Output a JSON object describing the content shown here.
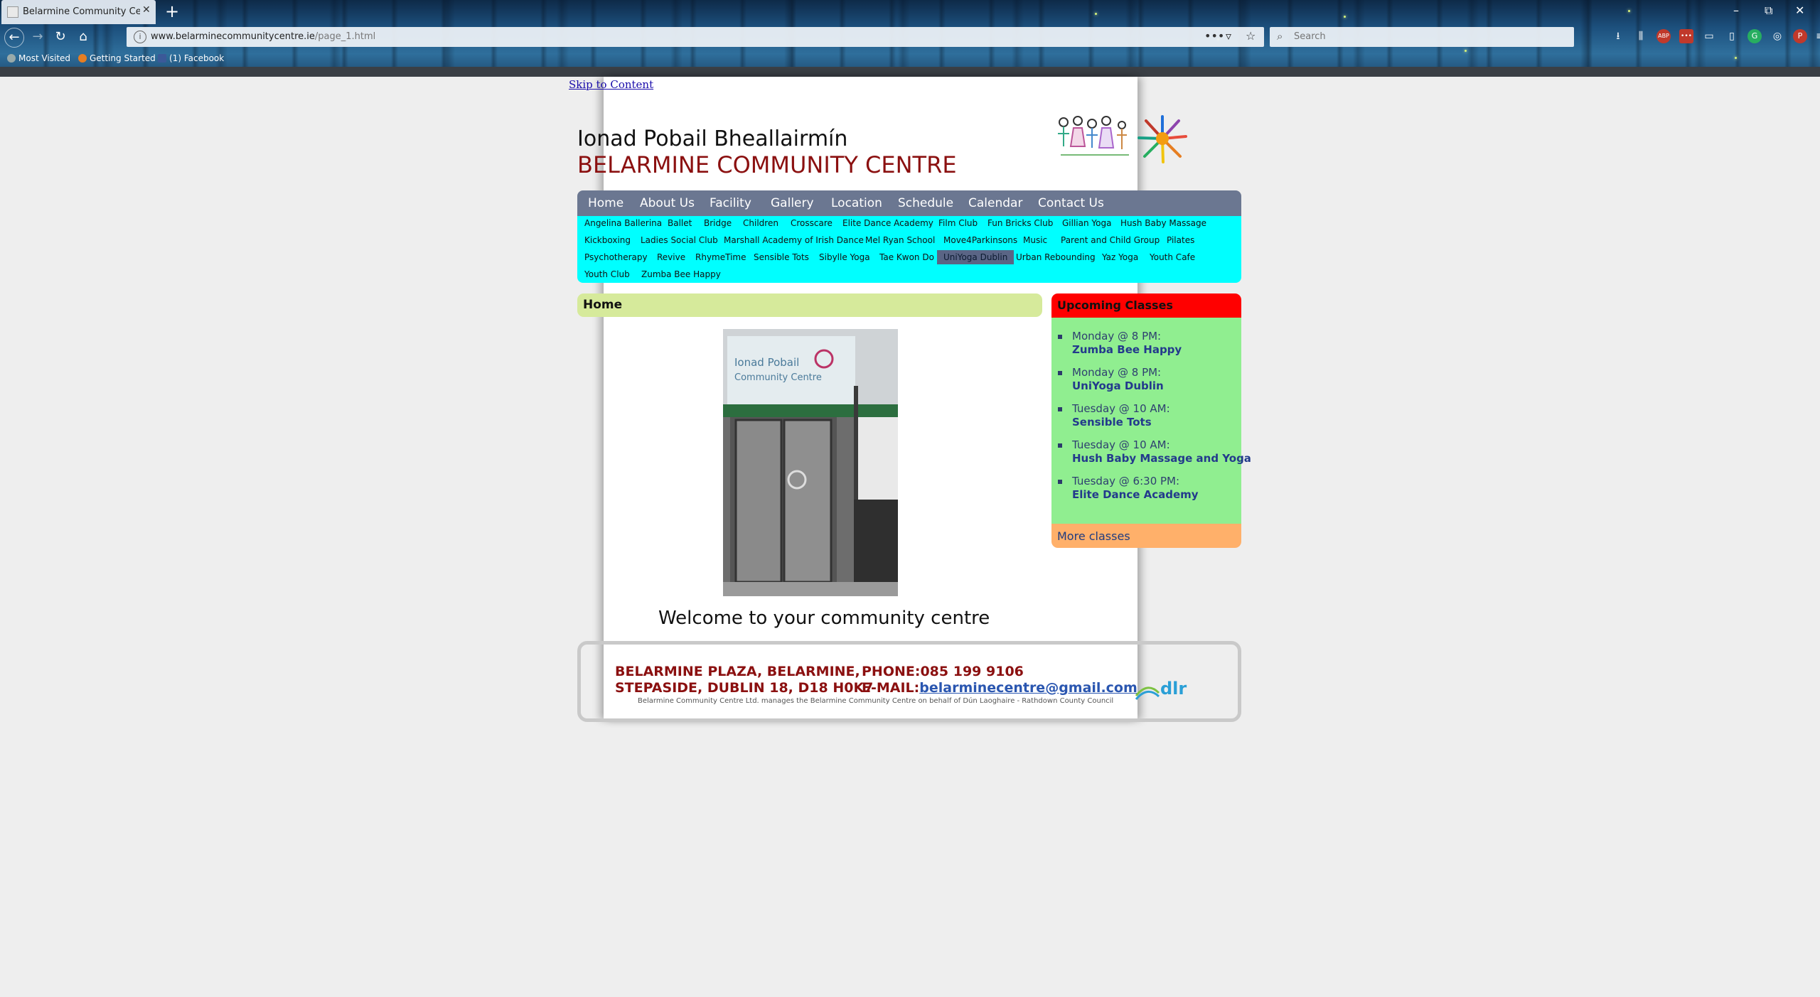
{
  "browser": {
    "tab_title": "Belarmine Community Centre",
    "url_domain": "www.belarminecommunitycentre.ie",
    "url_path": "/page_1.html",
    "search_placeholder": "Search",
    "bookmarks": [
      "Most Visited",
      "Getting Started",
      "(1) Facebook"
    ]
  },
  "page": {
    "skip_link": "Skip to Content",
    "title_irish": "Ionad Pobail Bheallairmín",
    "title_english": "BELARMINE COMMUNITY CENTRE",
    "main_nav": [
      "Home",
      "About Us",
      "Facility",
      "Gallery",
      "Location",
      "Schedule",
      "Calendar",
      "Contact Us"
    ],
    "sub_nav": [
      "Angelina Ballerina",
      "Ballet",
      "Bridge",
      "Children",
      "Crosscare",
      "Elite Dance Academy",
      "Film Club",
      "Fun Bricks Club",
      "Gillian Yoga",
      "Hush Baby Massage",
      "Kickboxing",
      "Ladies Social Club",
      "Marshall Academy of Irish Dance",
      "Mel Ryan School",
      "Move4Parkinsons",
      "Music",
      "Parent and Child Group",
      "Pilates",
      "Psychotherapy",
      "Revive",
      "RhymeTime",
      "Sensible Tots",
      "Sibylle Yoga",
      "Tae Kwon Do",
      "UniYoga Dublin",
      "Urban Rebounding",
      "Yaz Yoga",
      "Youth Cafe",
      "Youth Club",
      "Zumba Bee Happy"
    ],
    "active_sub_nav": "UniYoga Dublin",
    "section_heading": "Home",
    "welcome_text": "Welcome to your community centre",
    "upcoming": {
      "heading": "Upcoming Classes",
      "classes": [
        {
          "when": "Monday @ 8 PM:",
          "name": "Zumba Bee Happy"
        },
        {
          "when": "Monday @ 8 PM:",
          "name": "UniYoga Dublin"
        },
        {
          "when": "Tuesday @ 10 AM:",
          "name": "Sensible Tots"
        },
        {
          "when": "Tuesday @ 10 AM:",
          "name": "Hush Baby Massage and Yoga"
        },
        {
          "when": "Tuesday @ 6:30 PM:",
          "name": "Elite Dance Academy"
        }
      ],
      "more_link": "More classes"
    },
    "footer": {
      "address_line1": "BELARMINE PLAZA, BELARMINE,",
      "address_line2": "STEPASIDE, DUBLIN 18, D18 H0K7",
      "phone": "PHONE:085 199 9106",
      "email_label": "E-MAIL:",
      "email": "belarminecentre@gmail.com",
      "note": "Belarmine Community Centre Ltd. manages the Belarmine Community Centre on behalf of Dún Laoghaire - Rathdown County Council",
      "logo_text": "dlr"
    }
  },
  "colors": {
    "title_red": "#8b1010",
    "nav_bg": "#6b7791",
    "subnav_bg": "#00ffff",
    "home_bar": "#d6ea9b",
    "upcoming_head": "#ff0000",
    "upcoming_body": "#90ee90",
    "more_classes": "#ffb06a"
  }
}
